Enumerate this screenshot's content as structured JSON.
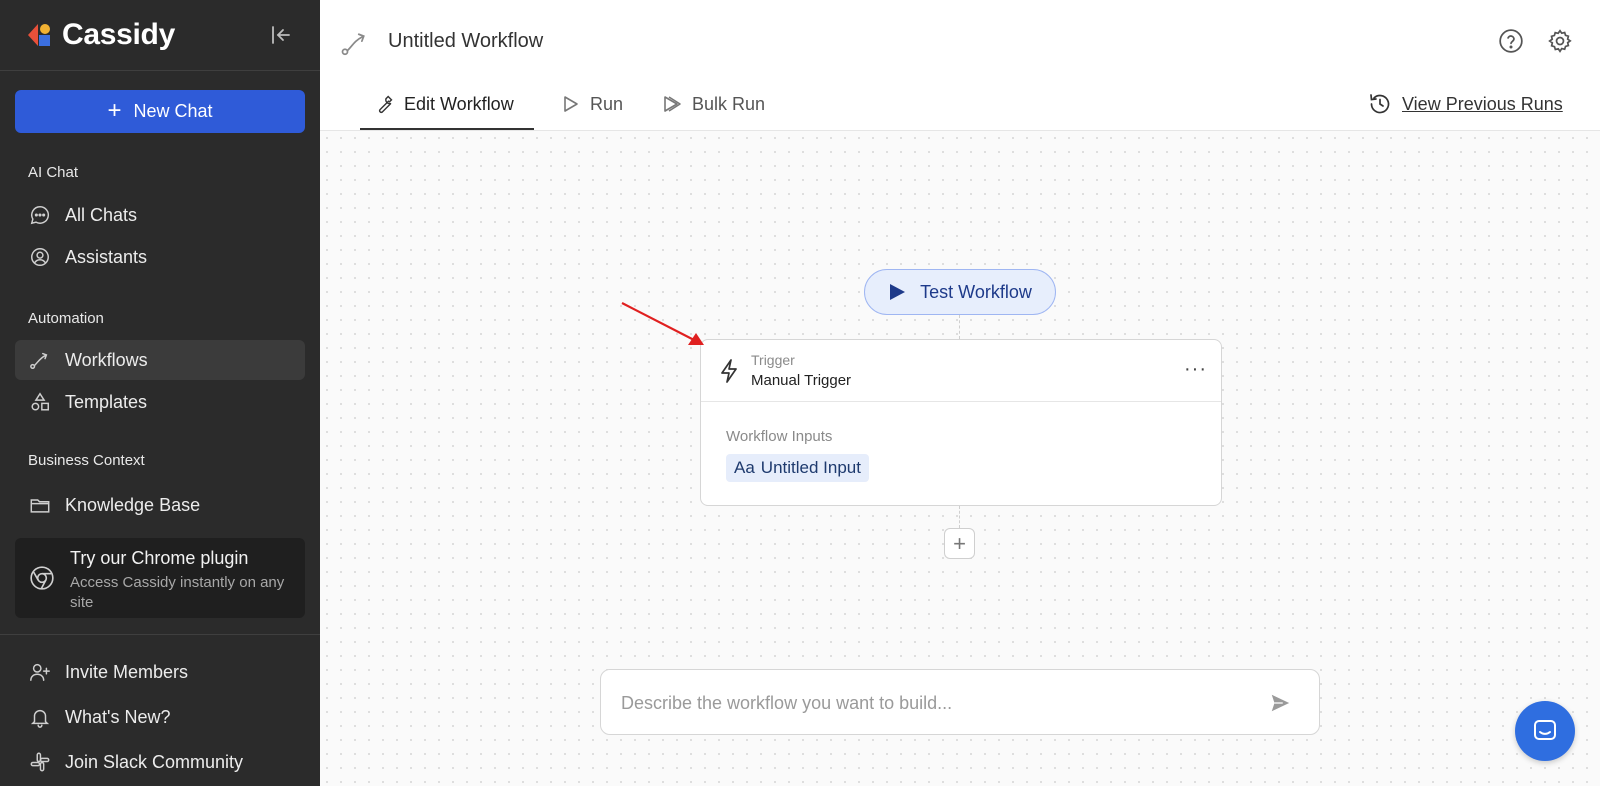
{
  "sidebar": {
    "brand": "Cassidy",
    "new_chat_label": "New Chat",
    "sections": {
      "ai_chat": "AI Chat",
      "automation": "Automation",
      "business_context": "Business Context"
    },
    "items": {
      "all_chats": "All Chats",
      "assistants": "Assistants",
      "workflows": "Workflows",
      "templates": "Templates",
      "knowledge_base": "Knowledge Base",
      "invite_members": "Invite Members",
      "whats_new": "What's New?",
      "join_slack": "Join Slack Community"
    },
    "chrome_card": {
      "title": "Try our Chrome plugin",
      "description": "Access Cassidy instantly on any site"
    }
  },
  "header": {
    "title": "Untitled Workflow",
    "tabs": {
      "edit": "Edit Workflow",
      "run": "Run",
      "bulk_run": "Bulk Run"
    },
    "view_previous_runs": "View Previous Runs"
  },
  "canvas": {
    "test_workflow_label": "Test Workflow",
    "trigger_node": {
      "type_label": "Trigger",
      "title": "Manual Trigger",
      "menu": "···",
      "inputs_label": "Workflow Inputs",
      "input_prefix": "Aa",
      "input_name": "Untitled Input"
    },
    "add_step": "+"
  },
  "prompt": {
    "placeholder": "Describe the workflow you want to build..."
  },
  "colors": {
    "sidebar_bg": "#2b2b2b",
    "accent": "#2f5bd8",
    "chat_bubble": "#2f6ee0",
    "arrow": "#e02020"
  }
}
